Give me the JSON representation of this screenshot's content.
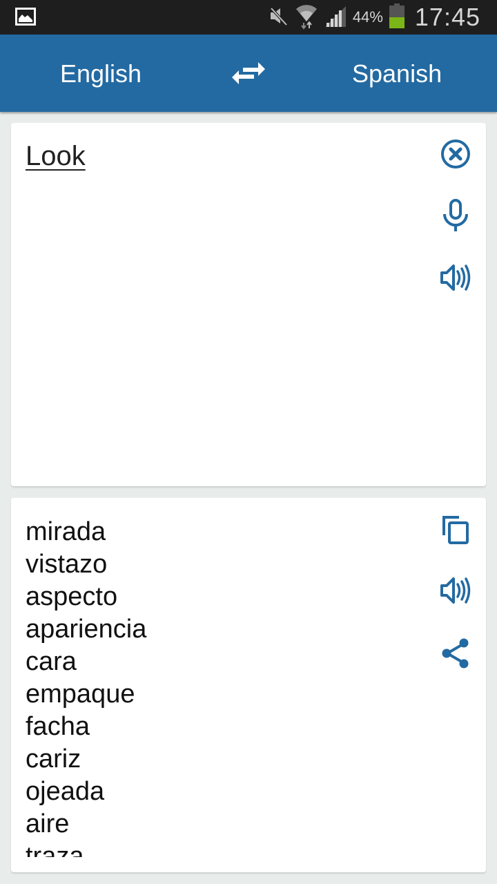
{
  "status_bar": {
    "notification_icon": "image-icon",
    "icons": [
      "mute-icon",
      "wifi-icon",
      "signal-icon"
    ],
    "battery_percent": "44%",
    "battery_level": 0.44,
    "time": "17:45"
  },
  "app_bar": {
    "source_language": "English",
    "swap_icon": "swap-arrows-icon",
    "target_language": "Spanish"
  },
  "input_card": {
    "text": "Look",
    "actions": [
      {
        "name": "clear",
        "icon": "close-circle-icon"
      },
      {
        "name": "voice-input",
        "icon": "microphone-icon"
      },
      {
        "name": "speak-input",
        "icon": "speaker-icon"
      }
    ]
  },
  "output_card": {
    "translations": [
      "mirada",
      "vistazo",
      "aspecto",
      "apariencia",
      "cara",
      "empaque",
      "facha",
      "cariz",
      "ojeada",
      "aire",
      "traza"
    ],
    "actions": [
      {
        "name": "copy",
        "icon": "copy-icon"
      },
      {
        "name": "speak-output",
        "icon": "speaker-icon"
      },
      {
        "name": "share",
        "icon": "share-icon"
      }
    ]
  },
  "colors": {
    "primary": "#236aa2",
    "icon": "#236aa2",
    "background": "#e8eceb",
    "battery_fill": "#7cb518"
  }
}
